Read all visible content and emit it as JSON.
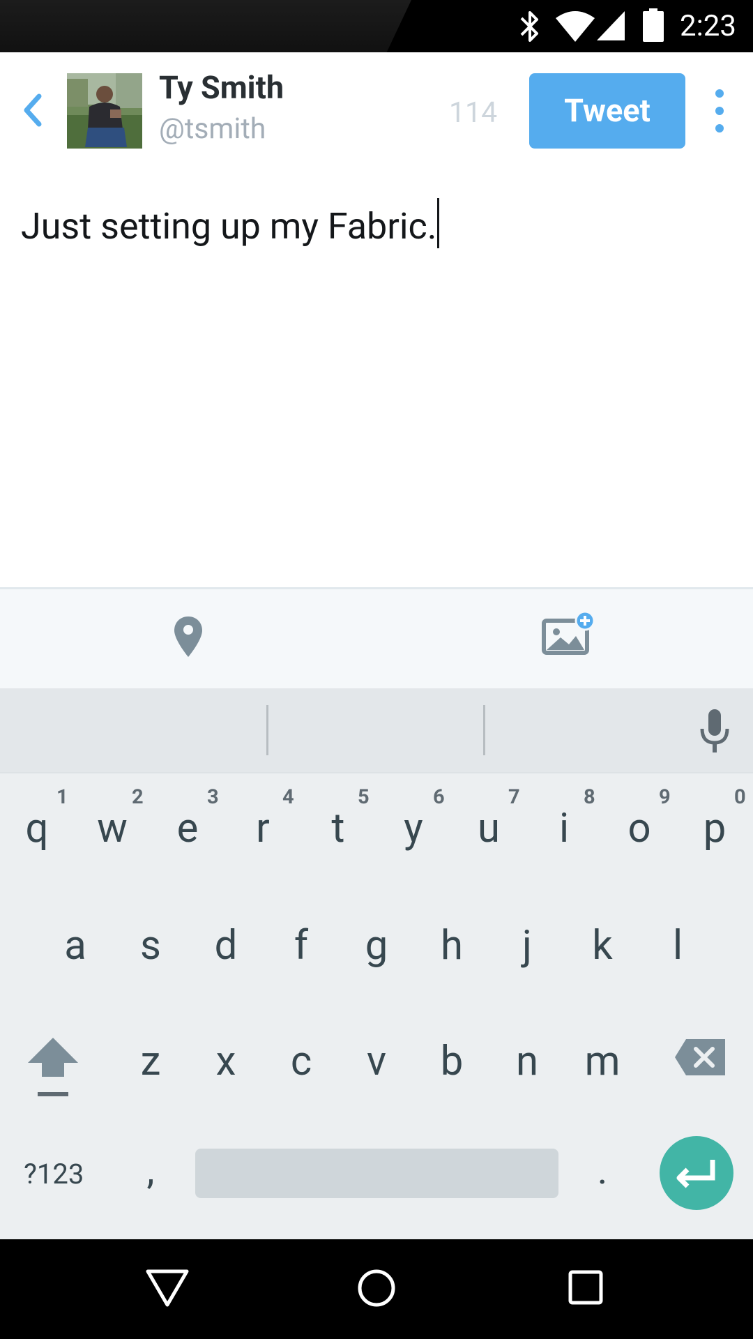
{
  "status_bar": {
    "time": "2:23",
    "icons": [
      "bluetooth-icon",
      "wifi-icon",
      "cell-signal-icon",
      "battery-icon"
    ]
  },
  "header": {
    "back_icon": "chevron-left-icon",
    "display_name": "Ty Smith",
    "handle": "@tsmith",
    "char_count": "114",
    "tweet_label": "Tweet",
    "more_icon": "overflow-menu-icon"
  },
  "compose": {
    "text": "Just setting up my Fabric."
  },
  "attachments": {
    "icons": [
      "location-pin-icon",
      "add-photo-icon"
    ]
  },
  "keyboard": {
    "row1": [
      {
        "k": "q",
        "h": "1"
      },
      {
        "k": "w",
        "h": "2"
      },
      {
        "k": "e",
        "h": "3"
      },
      {
        "k": "r",
        "h": "4"
      },
      {
        "k": "t",
        "h": "5"
      },
      {
        "k": "y",
        "h": "6"
      },
      {
        "k": "u",
        "h": "7"
      },
      {
        "k": "i",
        "h": "8"
      },
      {
        "k": "o",
        "h": "9"
      },
      {
        "k": "p",
        "h": "0"
      }
    ],
    "row2": [
      "a",
      "s",
      "d",
      "f",
      "g",
      "h",
      "j",
      "k",
      "l"
    ],
    "row3": [
      "z",
      "x",
      "c",
      "v",
      "b",
      "n",
      "m"
    ],
    "symbols_label": "?123",
    "comma": ",",
    "period": "."
  },
  "colors": {
    "accent": "#55acee",
    "enter": "#42b5a6",
    "keyboard_bg": "#eceff1"
  }
}
